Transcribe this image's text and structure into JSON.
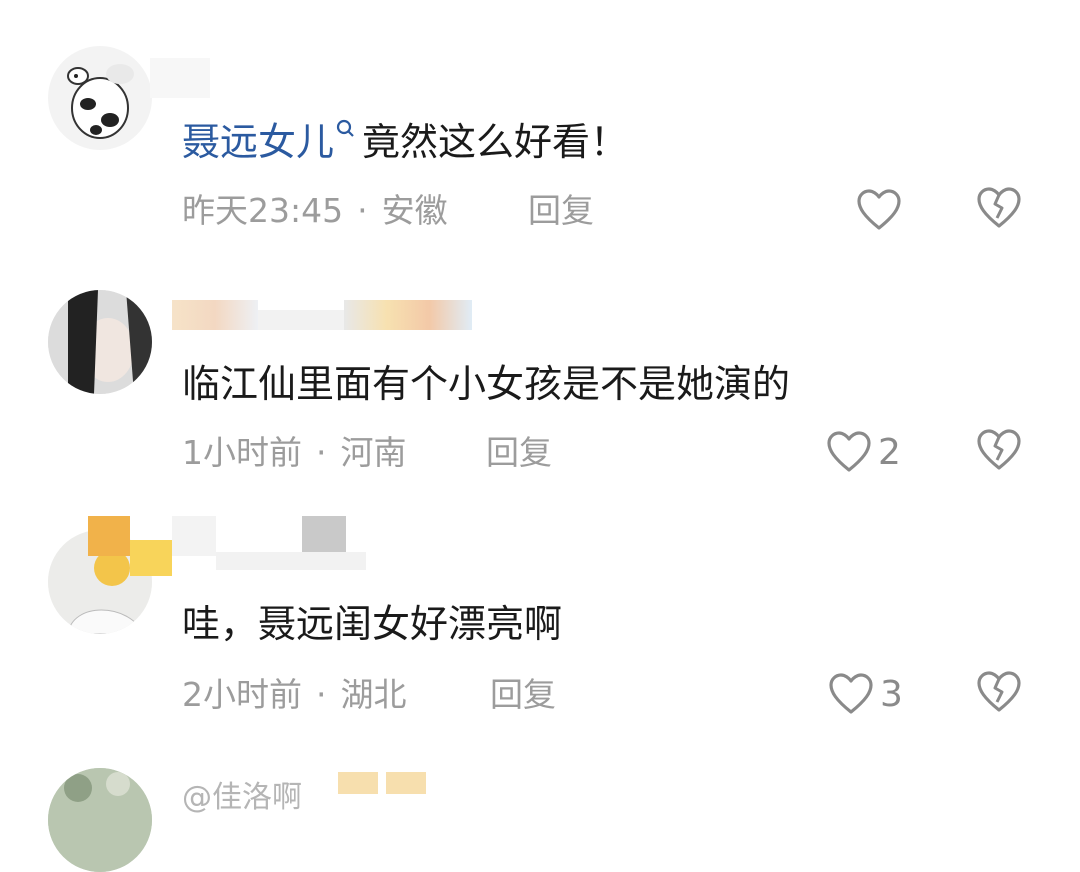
{
  "comments": [
    {
      "mention": "聂远女儿",
      "text": "竟然这么好看！",
      "time": "昨天23:45",
      "location": "安徽",
      "reply_label": "回复",
      "likes": ""
    },
    {
      "text": "临江仙里面有个小女孩是不是她演的",
      "time": "1小时前",
      "location": "河南",
      "reply_label": "回复",
      "likes": "2"
    },
    {
      "text": "哇，聂远闺女好漂亮啊",
      "time": "2小时前",
      "location": "湖北",
      "reply_label": "回复",
      "likes": "3"
    },
    {
      "nickname": "@佳洛啊"
    }
  ],
  "icons": {
    "like": "heart-outline-icon",
    "dislike": "broken-heart-icon",
    "search": "search-icon"
  },
  "colors": {
    "mention": "#2b5aa0",
    "meta": "#9c9c9c",
    "text": "#1a1a1a",
    "icon": "#8a8a8a"
  }
}
